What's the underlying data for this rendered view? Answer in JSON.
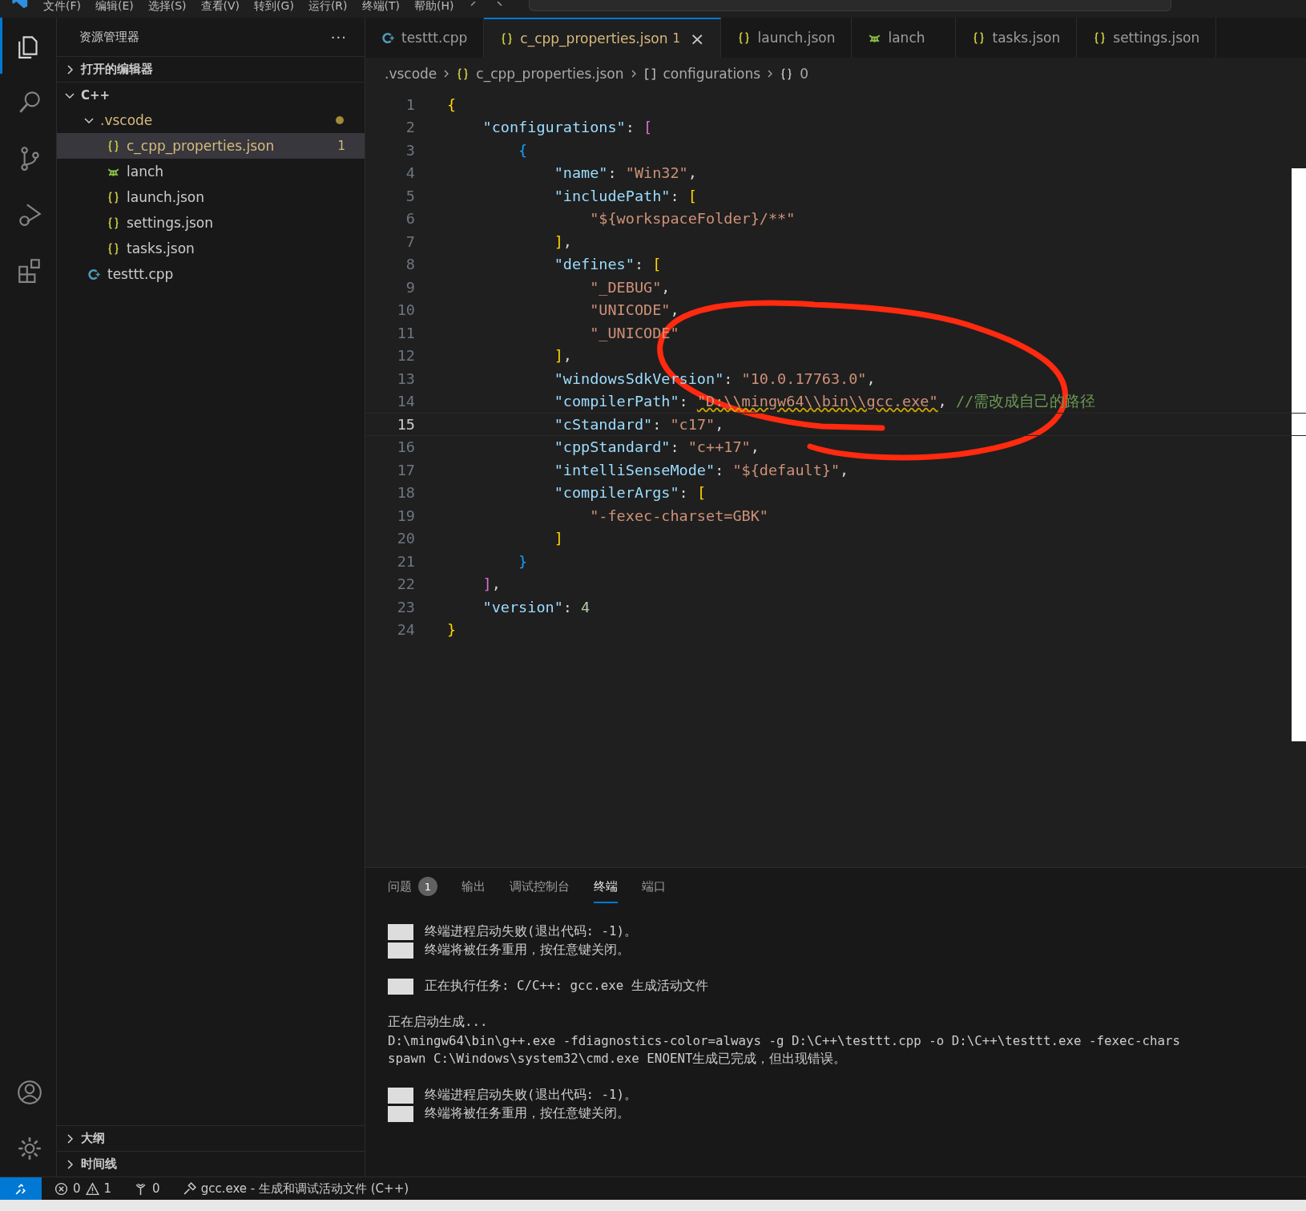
{
  "menu": [
    "文件(F)",
    "编辑(E)",
    "选择(S)",
    "查看(V)",
    "转到(G)",
    "运行(R)",
    "终端(T)",
    "帮助(H)"
  ],
  "activity_bar": [
    {
      "kind": "explorer",
      "selected": true
    },
    {
      "kind": "search",
      "selected": false
    },
    {
      "kind": "source-control",
      "selected": false
    },
    {
      "kind": "run-debug",
      "selected": false
    },
    {
      "kind": "extensions",
      "selected": false
    }
  ],
  "sidebar": {
    "title": "资源管理器",
    "more": "···",
    "sections_top": [
      {
        "label": "打开的编辑器",
        "expanded": false
      }
    ],
    "tree": {
      "label": "C++",
      "expanded": true,
      "children": [
        {
          "label": ".vscode",
          "kind": "folder",
          "expanded": true,
          "modified": true,
          "children": [
            {
              "label": "c_cpp_properties.json",
              "kind": "json",
              "selected": true,
              "badge": "1"
            },
            {
              "label": "lanch",
              "kind": "lanch",
              "selected": false
            },
            {
              "label": "launch.json",
              "kind": "json",
              "selected": false
            },
            {
              "label": "settings.json",
              "kind": "json",
              "selected": false
            },
            {
              "label": "tasks.json",
              "kind": "json",
              "selected": false
            }
          ]
        },
        {
          "label": "testtt.cpp",
          "kind": "cpp",
          "selected": false
        }
      ]
    },
    "sections_bottom": [
      {
        "label": "大纲",
        "expanded": false
      },
      {
        "label": "时间线",
        "expanded": false
      }
    ]
  },
  "tabs": [
    {
      "label": "testtt.cpp",
      "kind": "cpp",
      "selected": false
    },
    {
      "label": "c_cpp_properties.json",
      "kind": "json",
      "selected": true,
      "badge": "1",
      "close": "×"
    },
    {
      "label": "launch.json",
      "kind": "json",
      "selected": false
    },
    {
      "label": "lanch",
      "kind": "lanch",
      "selected": false
    },
    {
      "label": "tasks.json",
      "kind": "json",
      "selected": false
    },
    {
      "label": "settings.json",
      "kind": "json",
      "selected": false
    }
  ],
  "breadcrumbs": [
    {
      "label": ".vscode",
      "kind": "folder"
    },
    {
      "label": "c_cpp_properties.json",
      "kind": "json"
    },
    {
      "label": "configurations",
      "kind": "array"
    },
    {
      "label": "0",
      "kind": "object"
    }
  ],
  "code": [
    {
      "n": "1",
      "current": false,
      "t": [
        {
          "kind": "b1",
          "text": "{"
        }
      ]
    },
    {
      "n": "2",
      "current": false,
      "t": [
        {
          "kind": "k",
          "text": "    \"configurations\""
        },
        {
          "kind": "p",
          "text": ": "
        },
        {
          "kind": "b2",
          "text": "["
        }
      ]
    },
    {
      "n": "3",
      "current": false,
      "t": [
        {
          "kind": "b3",
          "text": "        {"
        }
      ]
    },
    {
      "n": "4",
      "current": false,
      "t": [
        {
          "kind": "k",
          "text": "            \"name\""
        },
        {
          "kind": "p",
          "text": ": "
        },
        {
          "kind": "s",
          "text": "\"Win32\""
        },
        {
          "kind": "p",
          "text": ","
        }
      ]
    },
    {
      "n": "5",
      "current": false,
      "t": [
        {
          "kind": "k",
          "text": "            \"includePath\""
        },
        {
          "kind": "p",
          "text": ": "
        },
        {
          "kind": "b1",
          "text": "["
        }
      ]
    },
    {
      "n": "6",
      "current": false,
      "t": [
        {
          "kind": "s",
          "text": "                \"${workspaceFolder}/**\""
        }
      ]
    },
    {
      "n": "7",
      "current": false,
      "t": [
        {
          "kind": "b1",
          "text": "            ]"
        },
        {
          "kind": "p",
          "text": ","
        }
      ]
    },
    {
      "n": "8",
      "current": false,
      "t": [
        {
          "kind": "k",
          "text": "            \"defines\""
        },
        {
          "kind": "p",
          "text": ": "
        },
        {
          "kind": "b1",
          "text": "["
        }
      ]
    },
    {
      "n": "9",
      "current": false,
      "t": [
        {
          "kind": "s",
          "text": "                \"_DEBUG\""
        },
        {
          "kind": "p",
          "text": ","
        }
      ]
    },
    {
      "n": "10",
      "current": false,
      "t": [
        {
          "kind": "s",
          "text": "                \"UNICODE\""
        },
        {
          "kind": "p",
          "text": ","
        }
      ]
    },
    {
      "n": "11",
      "current": false,
      "t": [
        {
          "kind": "s",
          "text": "                \"_UNICODE\""
        }
      ]
    },
    {
      "n": "12",
      "current": false,
      "t": [
        {
          "kind": "b1",
          "text": "            ]"
        },
        {
          "kind": "p",
          "text": ","
        }
      ]
    },
    {
      "n": "13",
      "current": false,
      "t": [
        {
          "kind": "k",
          "text": "            \"windowsSdkVersion\""
        },
        {
          "kind": "p",
          "text": ": "
        },
        {
          "kind": "s",
          "text": "\"10.0.17763.0\""
        },
        {
          "kind": "p",
          "text": ","
        }
      ]
    },
    {
      "n": "14",
      "current": false,
      "t": [
        {
          "kind": "k",
          "text": "            \"compilerPath\""
        },
        {
          "kind": "p",
          "text": ": "
        },
        {
          "kind": "sw",
          "text": "\"D:\\\\mingw64\\\\bin\\\\gcc.exe\""
        },
        {
          "kind": "p",
          "text": ", "
        },
        {
          "kind": "c",
          "text": "//需改成自己的路径"
        }
      ]
    },
    {
      "n": "15",
      "current": true,
      "t": [
        {
          "kind": "k",
          "text": "            \"cStandard\""
        },
        {
          "kind": "p",
          "text": ": "
        },
        {
          "kind": "s",
          "text": "\"c17\""
        },
        {
          "kind": "p",
          "text": ","
        }
      ]
    },
    {
      "n": "16",
      "current": false,
      "t": [
        {
          "kind": "k",
          "text": "            \"cppStandard\""
        },
        {
          "kind": "p",
          "text": ": "
        },
        {
          "kind": "s",
          "text": "\"c++17\""
        },
        {
          "kind": "p",
          "text": ","
        }
      ]
    },
    {
      "n": "17",
      "current": false,
      "t": [
        {
          "kind": "k",
          "text": "            \"intelliSenseMode\""
        },
        {
          "kind": "p",
          "text": ": "
        },
        {
          "kind": "s",
          "text": "\"${default}\""
        },
        {
          "kind": "p",
          "text": ","
        }
      ]
    },
    {
      "n": "18",
      "current": false,
      "t": [
        {
          "kind": "k",
          "text": "            \"compilerArgs\""
        },
        {
          "kind": "p",
          "text": ": "
        },
        {
          "kind": "b1",
          "text": "["
        }
      ]
    },
    {
      "n": "19",
      "current": false,
      "t": [
        {
          "kind": "s",
          "text": "                \"-fexec-charset=GBK\""
        }
      ]
    },
    {
      "n": "20",
      "current": false,
      "t": [
        {
          "kind": "b1",
          "text": "            ]"
        }
      ]
    },
    {
      "n": "21",
      "current": false,
      "t": [
        {
          "kind": "b3",
          "text": "        }"
        }
      ]
    },
    {
      "n": "22",
      "current": false,
      "t": [
        {
          "kind": "b2",
          "text": "    ]"
        },
        {
          "kind": "p",
          "text": ","
        }
      ]
    },
    {
      "n": "23",
      "current": false,
      "t": [
        {
          "kind": "k",
          "text": "    \"version\""
        },
        {
          "kind": "p",
          "text": ": "
        },
        {
          "kind": "n",
          "text": "4"
        }
      ]
    },
    {
      "n": "24",
      "current": false,
      "t": [
        {
          "kind": "b1",
          "text": "}"
        }
      ]
    }
  ],
  "panel": {
    "tabs": [
      {
        "label": "问题",
        "badge": "1",
        "selected": false
      },
      {
        "label": "输出",
        "selected": false
      },
      {
        "label": "调试控制台",
        "selected": false
      },
      {
        "label": "终端",
        "selected": true
      },
      {
        "label": "端口",
        "selected": false
      }
    ],
    "terminal": [
      {
        "kind": "marked",
        "lines": [
          "终端进程启动失败(退出代码: -1)。",
          "终端将被任务重用，按任意键关闭。"
        ]
      },
      {
        "kind": "marked",
        "lines": [
          "正在执行任务: C/C++: gcc.exe 生成活动文件"
        ]
      },
      {
        "kind": "plain",
        "lines": [
          "正在启动生成...",
          "D:\\mingw64\\bin\\g++.exe -fdiagnostics-color=always -g D:\\C++\\testtt.cpp -o D:\\C++\\testtt.exe -fexec-chars",
          "spawn C:\\Windows\\system32\\cmd.exe ENOENT生成已完成，但出现错误。"
        ]
      },
      {
        "kind": "marked",
        "lines": [
          "终端进程启动失败(退出代码: -1)。",
          "终端将被任务重用，按任意键关闭。"
        ]
      }
    ]
  },
  "status_bar": {
    "errors": "0",
    "warnings": "1",
    "ports": "0",
    "task": "gcc.exe - 生成和调试活动文件 (C++)"
  }
}
